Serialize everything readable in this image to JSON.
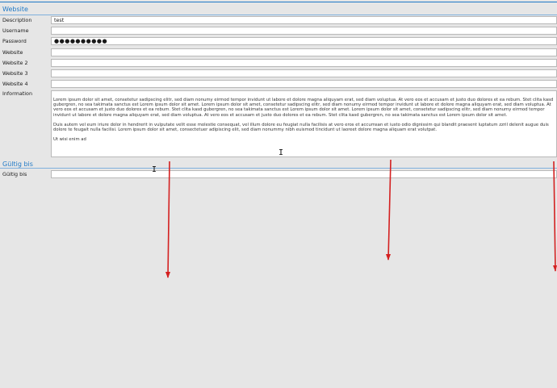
{
  "sections": {
    "website": {
      "title": "Website"
    },
    "validity": {
      "title": "Gültig bis"
    }
  },
  "fields": {
    "description": {
      "label": "Description",
      "value": "test"
    },
    "username": {
      "label": "Username",
      "value": ""
    },
    "password": {
      "label": "Password",
      "value": "●●●●●●●●●●"
    },
    "website": {
      "label": "Website",
      "value": ""
    },
    "website2": {
      "label": "Website 2",
      "value": ""
    },
    "website3": {
      "label": "Website 3",
      "value": ""
    },
    "website4": {
      "label": "Website 4",
      "value": ""
    },
    "information": {
      "label": "Information",
      "paragraph1": "Lorem ipsum dolor sit amet, consetetur sadipscing elitr, sed diam nonumy eirmod tempor invidunt ut labore et dolore magna aliquyam erat, sed diam voluptua. At vero eos et accusam et justo duo dolores et ea rebum. Stet clita kasd gubergren, no sea takimata sanctus est Lorem ipsum dolor sit amet. Lorem ipsum dolor sit amet, consetetur sadipscing elitr, sed diam nonumy eirmod tempor invidunt ut labore et dolore magna aliquyam erat, sed diam voluptua. At vero eos et accusam et justo duo dolores et ea rebum. Stet clita kasd gubergren, no sea takimata sanctus est Lorem ipsum dolor sit amet. Lorem ipsum dolor sit amet, consetetur sadipscing elitr, sed diam nonumy eirmod tempor invidunt ut labore et dolore magna aliquyam erat, sed diam voluptua. At vero eos et accusam et justo duo dolores et ea rebum. Stet clita kasd gubergren, no sea takimata sanctus est Lorem ipsum dolor sit amet.",
      "paragraph2": "Duis autem vel eum iriure dolor in hendrerit in vulputate velit esse molestie consequat, vel illum dolore eu feugiat nulla facilisis at vero eros et accumsan et iusto odio dignissim qui blandit praesent luptatum zzril delenit augue duis dolore te feugait nulla facilisi. Lorem ipsum dolor sit amet, consectetuer adipiscing elit, sed diam nonummy nibh euismod tincidunt ut laoreet dolore magna aliquam erat volutpat.",
      "paragraph3": "Ut wisi enim ad"
    },
    "valid_until": {
      "label": "Gültig bis",
      "value": ""
    }
  },
  "cursor_glyph": "I",
  "colors": {
    "accent": "#1f79c7",
    "arrow": "#d42020",
    "background": "#e6e6e6"
  }
}
